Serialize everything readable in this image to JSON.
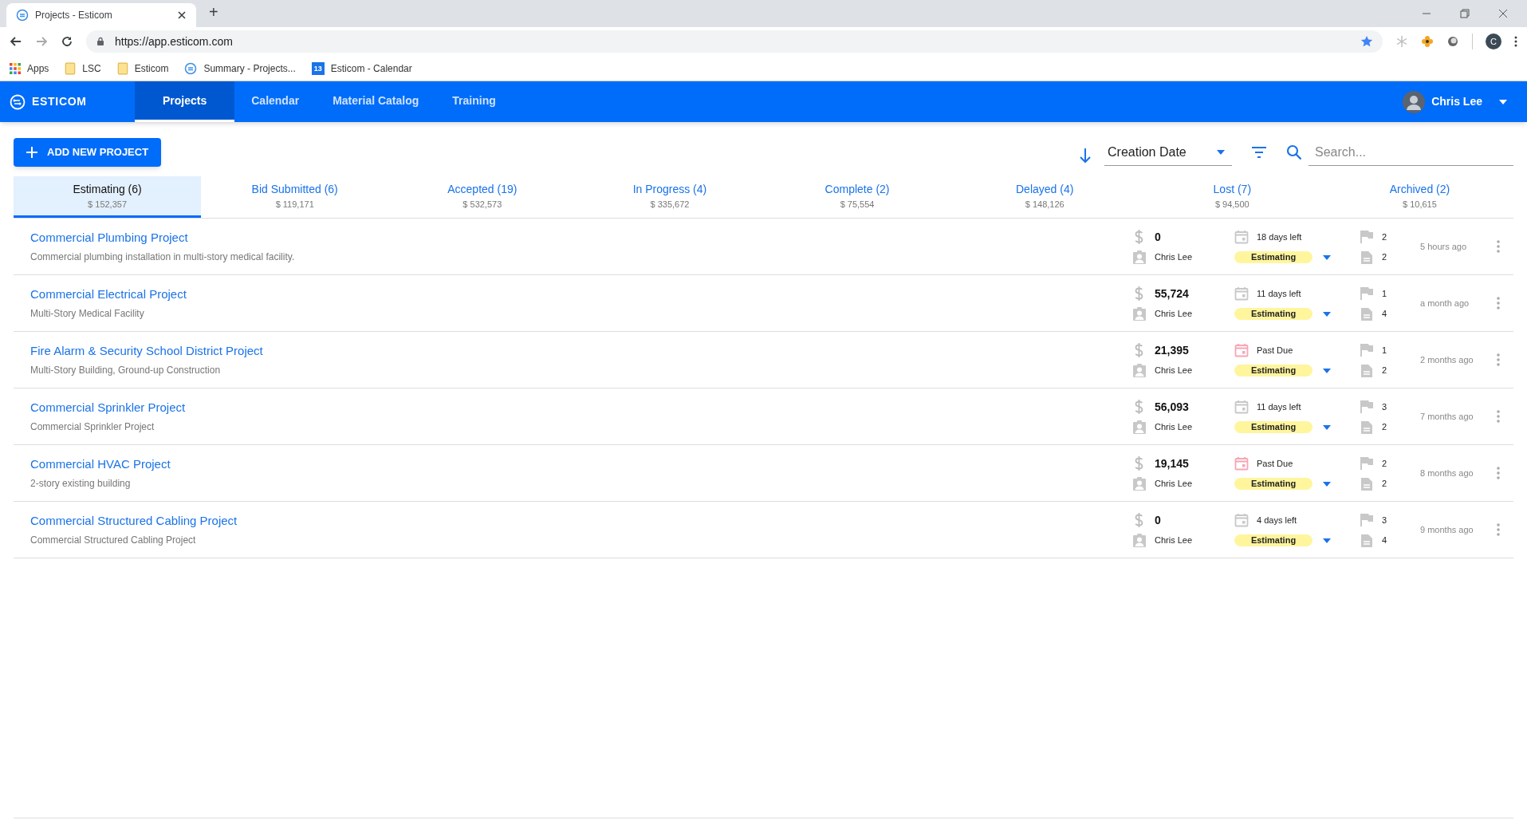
{
  "browser": {
    "tab_title": "Projects - Esticom",
    "new_tab": "+",
    "url": "https://app.esticom.com",
    "profile_initial": "C",
    "bookmarks": [
      {
        "kind": "apps",
        "label": "Apps"
      },
      {
        "kind": "folder",
        "label": "LSC"
      },
      {
        "kind": "folder",
        "label": "Esticom"
      },
      {
        "kind": "site",
        "label": "Summary - Projects..."
      },
      {
        "kind": "calendar",
        "label": "Esticom - Calendar",
        "badge": "13"
      }
    ]
  },
  "app": {
    "logo": "ESTICOM",
    "nav": [
      {
        "label": "Projects",
        "selected": true
      },
      {
        "label": "Calendar",
        "selected": false
      },
      {
        "label": "Material Catalog",
        "selected": false
      },
      {
        "label": "Training",
        "selected": false
      }
    ],
    "user": "Chris Lee"
  },
  "toolbar": {
    "add_button": "ADD NEW PROJECT",
    "sort": "Creation Date",
    "search": {
      "placeholder": "Search..."
    }
  },
  "status_tabs": [
    {
      "label": "Estimating (6)",
      "total": "$ 152,357",
      "selected": true
    },
    {
      "label": "Bid Submitted (6)",
      "total": "$ 119,171",
      "selected": false
    },
    {
      "label": "Accepted (19)",
      "total": "$ 532,573",
      "selected": false
    },
    {
      "label": "In Progress (4)",
      "total": "$ 335,672",
      "selected": false
    },
    {
      "label": "Complete (2)",
      "total": "$ 75,554",
      "selected": false
    },
    {
      "label": "Delayed (4)",
      "total": "$ 148,126",
      "selected": false
    },
    {
      "label": "Lost (7)",
      "total": "$ 94,500",
      "selected": false
    },
    {
      "label": "Archived (2)",
      "total": "$ 10,615",
      "selected": false
    }
  ],
  "projects": [
    {
      "title": "Commercial Plumbing Project",
      "description": "Commercial plumbing installation in multi-story medical facility.",
      "amount": "0",
      "owner": "Chris Lee",
      "due": "18 days left",
      "overdue": false,
      "status": "Estimating",
      "flags": "2",
      "documents": "2",
      "created": "5 hours ago"
    },
    {
      "title": "Commercial Electrical Project",
      "description": "Multi-Story Medical Facility",
      "amount": "55,724",
      "owner": "Chris Lee",
      "due": "11 days left",
      "overdue": false,
      "status": "Estimating",
      "flags": "1",
      "documents": "4",
      "created": "a month ago"
    },
    {
      "title": "Fire Alarm & Security School District Project",
      "description": "Multi-Story Building, Ground-up Construction",
      "amount": "21,395",
      "owner": "Chris Lee",
      "due": "Past Due",
      "overdue": true,
      "status": "Estimating",
      "flags": "1",
      "documents": "2",
      "created": "2 months ago"
    },
    {
      "title": "Commercial Sprinkler Project",
      "description": "Commercial Sprinkler Project",
      "amount": "56,093",
      "owner": "Chris Lee",
      "due": "11 days left",
      "overdue": false,
      "status": "Estimating",
      "flags": "3",
      "documents": "2",
      "created": "7 months ago"
    },
    {
      "title": "Commercial HVAC Project",
      "description": "2-story existing building",
      "amount": "19,145",
      "owner": "Chris Lee",
      "due": "Past Due",
      "overdue": true,
      "status": "Estimating",
      "flags": "2",
      "documents": "2",
      "created": "8 months ago"
    },
    {
      "title": "Commercial Structured Cabling Project",
      "description": "Commercial Structured Cabling Project",
      "amount": "0",
      "owner": "Chris Lee",
      "due": "4 days left",
      "overdue": false,
      "status": "Estimating",
      "flags": "3",
      "documents": "4",
      "created": "9 months ago"
    }
  ]
}
